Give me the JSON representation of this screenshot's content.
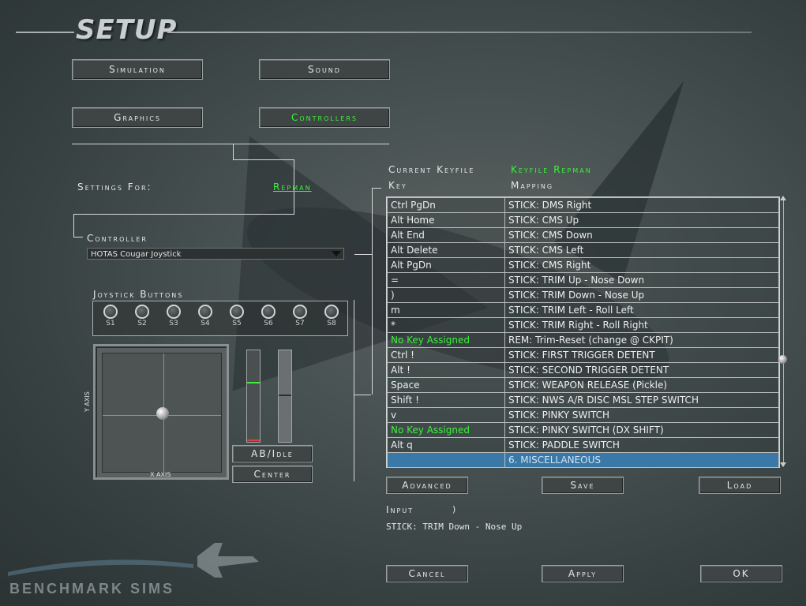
{
  "title": "SETUP",
  "tabs": [
    {
      "label": "Simulation",
      "active": false
    },
    {
      "label": "Sound",
      "active": false
    },
    {
      "label": "Graphics",
      "active": false
    },
    {
      "label": "Controllers",
      "active": true
    }
  ],
  "settings_for": {
    "label": "Settings For:",
    "value": "Repman"
  },
  "controller": {
    "label": "Controller",
    "selected": "HOTAS Cougar Joystick"
  },
  "joystick_buttons": {
    "label": "Joystick Buttons",
    "buttons": [
      "S1",
      "S2",
      "S3",
      "S4",
      "S5",
      "S6",
      "S7",
      "S8"
    ]
  },
  "axes": {
    "x_label": "X AXIS",
    "y_label": "Y AXIS"
  },
  "axis_buttons": {
    "ab_idle": "AB/Idle",
    "center": "Center"
  },
  "keyfile": {
    "label": "Current Keyfile",
    "value": "Keyfile Repman"
  },
  "table": {
    "headers": {
      "key": "Key",
      "mapping": "Mapping"
    },
    "rows": [
      {
        "key": "Ctrl PgDn",
        "mapping": "STICK: DMS Right",
        "unassigned": false
      },
      {
        "key": "Alt Home",
        "mapping": "STICK: CMS Up",
        "unassigned": false
      },
      {
        "key": "Alt End",
        "mapping": "STICK: CMS Down",
        "unassigned": false
      },
      {
        "key": "Alt Delete",
        "mapping": "STICK: CMS Left",
        "unassigned": false
      },
      {
        "key": "Alt PgDn",
        "mapping": "STICK: CMS Right",
        "unassigned": false
      },
      {
        "key": "=",
        "mapping": "STICK: TRIM Up - Nose Down",
        "unassigned": false
      },
      {
        "key": ")",
        "mapping": "STICK: TRIM Down - Nose Up",
        "unassigned": false
      },
      {
        "key": "m",
        "mapping": "STICK: TRIM Left - Roll Left",
        "unassigned": false
      },
      {
        "key": "*",
        "mapping": "STICK: TRIM Right - Roll Right",
        "unassigned": false
      },
      {
        "key": "No Key Assigned",
        "mapping": "REM: Trim-Reset (change @ CKPIT)",
        "unassigned": true
      },
      {
        "key": "Ctrl !",
        "mapping": "STICK: FIRST TRIGGER DETENT",
        "unassigned": false
      },
      {
        "key": "Alt !",
        "mapping": "STICK: SECOND TRIGGER DETENT",
        "unassigned": false
      },
      {
        "key": "Space",
        "mapping": "STICK: WEAPON RELEASE (Pickle)",
        "unassigned": false
      },
      {
        "key": "Shift !",
        "mapping": "STICK: NWS A/R DISC MSL STEP SWITCH",
        "unassigned": false
      },
      {
        "key": "v",
        "mapping": "STICK: PINKY SWITCH",
        "unassigned": false
      },
      {
        "key": "No Key Assigned",
        "mapping": "STICK: PINKY SWITCH (DX SHIFT)",
        "unassigned": true
      },
      {
        "key": "Alt q",
        "mapping": "STICK: PADDLE SWITCH",
        "unassigned": false
      },
      {
        "key": "",
        "mapping": "6. MISCELLANEOUS",
        "unassigned": false,
        "selected": true
      }
    ]
  },
  "actions": {
    "advanced": "Advanced",
    "save": "Save",
    "load": "Load"
  },
  "input": {
    "label": "Input",
    "value": ")"
  },
  "input_mapping": "STICK: TRIM Down - Nose Up",
  "footer": {
    "cancel": "Cancel",
    "apply": "Apply",
    "ok": "OK"
  },
  "logo": "BENCHMARK SIMS",
  "colors": {
    "highlight_green": "#3cf03c",
    "selection_blue": "#3a78a8"
  }
}
